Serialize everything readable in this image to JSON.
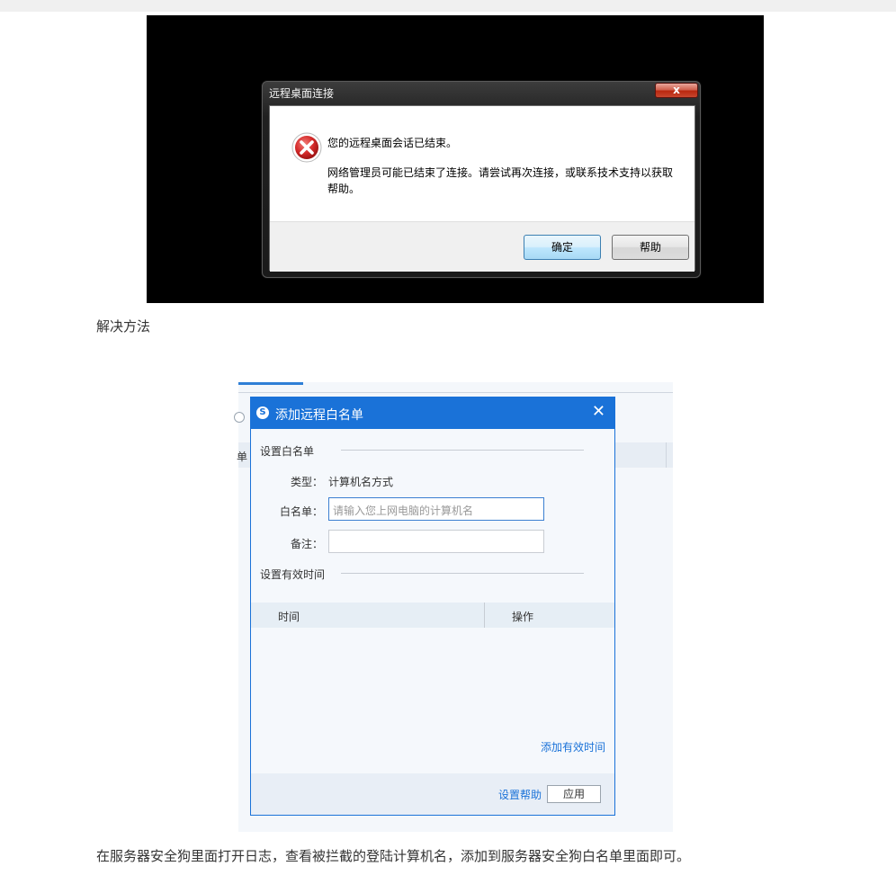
{
  "rdp_dialog": {
    "title": "远程桌面连接",
    "close_label": "x",
    "message_title": "您的远程桌面会话已结束。",
    "message_body": "网络管理员可能已结束了连接。请尝试再次连接，或联系技术支持以获取帮助。",
    "ok_label": "确定",
    "help_label": "帮助"
  },
  "section_heading": "解决方法",
  "whitelist_dialog": {
    "title": "添加远程白名单",
    "logo_letter": "S",
    "close_label": "✕",
    "section_whitelist": "设置白名单",
    "type_label": "类型：",
    "type_value": "计算机名方式",
    "whitelist_label": "白名单：",
    "whitelist_placeholder": "请输入您上网电脑的计算机名",
    "remark_label": "备注：",
    "section_time": "设置有效时间",
    "col_time": "时间",
    "col_action": "操作",
    "add_time_link": "添加有效时间",
    "help_link": "设置帮助",
    "apply_label": "应用"
  },
  "background_app": {
    "partial_label": "单"
  },
  "footer_text": "在服务器安全狗里面打开日志，查看被拦截的登陆计算机名，添加到服务器安全狗白名单里面即可。",
  "colors": {
    "accent": "#1a72d8",
    "error_red": "#c8202a"
  }
}
